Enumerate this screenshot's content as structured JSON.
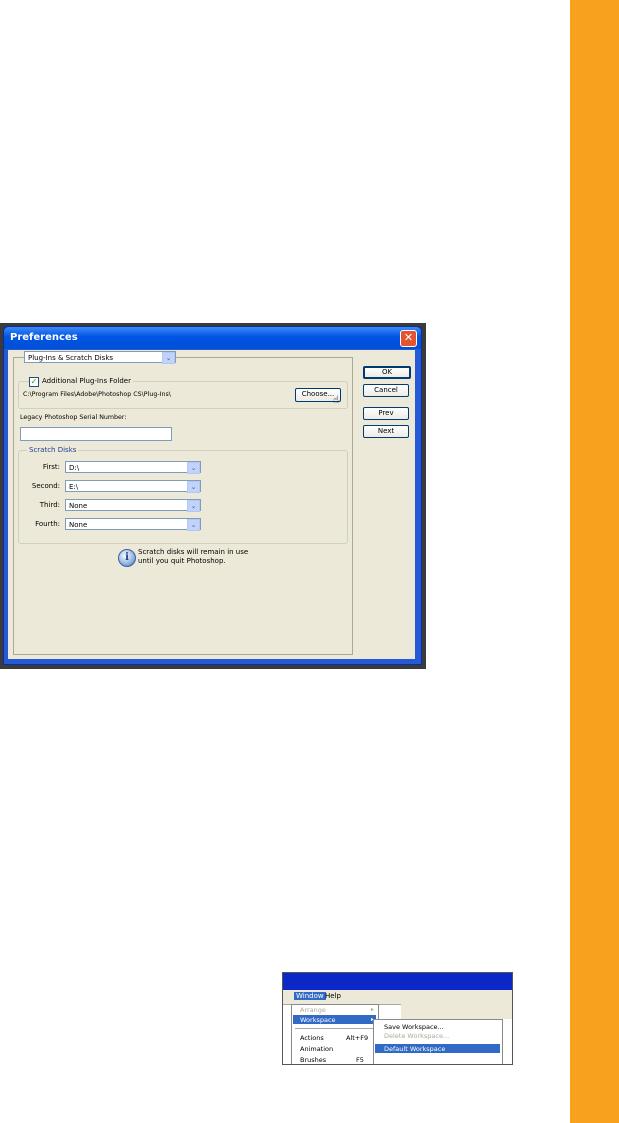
{
  "preferences": {
    "title": "Preferences",
    "panel_select": "Plug-Ins & Scratch Disks",
    "additional_plugins_label": "Additional Plug-Ins Folder",
    "plugins_path": "C:\\Program Files\\Adobe\\Photoshop CS\\Plug-Ins\\",
    "choose_label": "Choose...",
    "serial_label": "Legacy Photoshop Serial Number:",
    "serial_value": "",
    "scratch_group_label": "Scratch Disks",
    "scratch": [
      {
        "label": "First:",
        "value": "D:\\"
      },
      {
        "label": "Second:",
        "value": "E:\\"
      },
      {
        "label": "Third:",
        "value": "None"
      },
      {
        "label": "Fourth:",
        "value": "None"
      }
    ],
    "info_line1": "Scratch disks will remain in use",
    "info_line2": "until you quit Photoshop.",
    "buttons": {
      "ok": "OK",
      "cancel": "Cancel",
      "prev": "Prev",
      "next": "Next"
    }
  },
  "window_menu": {
    "menubar": {
      "window": "Window",
      "help": "Help"
    },
    "items": [
      "Arrange",
      "Workspace",
      "Actions",
      "Animation",
      "Brushes"
    ],
    "shortcuts": {
      "actions": "Alt+F9",
      "brushes": "F5"
    },
    "submenu": [
      "Save Workspace...",
      "Delete Workspace...",
      "Default Workspace"
    ]
  },
  "colors": {
    "accent_bar": "#f7a11f",
    "title_blue": "#0054e3",
    "highlight": "#316ac5"
  }
}
